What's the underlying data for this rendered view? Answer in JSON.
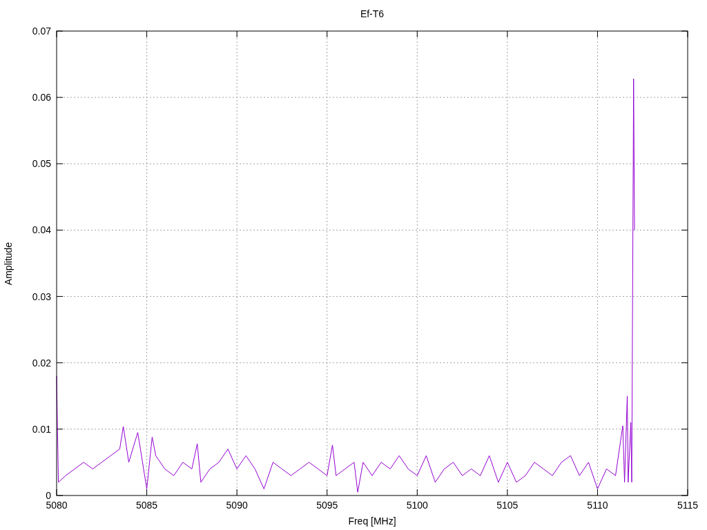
{
  "chart": {
    "chart_data": {
      "type": "line",
      "title": "Ef-T6",
      "xlabel": "Freq [MHz]",
      "ylabel": "Amplitude",
      "grid": true,
      "xlim": [
        5080,
        5115
      ],
      "ylim": [
        0,
        0.07
      ],
      "xticks": [
        5080,
        5085,
        5090,
        5095,
        5100,
        5105,
        5110,
        5115
      ],
      "yticks": [
        {
          "value": 0,
          "label": "0"
        },
        {
          "value": 0.01,
          "label": "0.01"
        },
        {
          "value": 0.02,
          "label": "0.02"
        },
        {
          "value": 0.03,
          "label": "0.03"
        },
        {
          "value": 0.04,
          "label": "0.04"
        },
        {
          "value": 0.05,
          "label": "0.05"
        },
        {
          "value": 0.06,
          "label": "0.06"
        },
        {
          "value": 0.07,
          "label": "0.07"
        }
      ],
      "x": [
        5080,
        5080.1,
        5080.5,
        5081,
        5081.5,
        5082,
        5082.5,
        5083,
        5083.5,
        5083.7,
        5084,
        5084.5,
        5085,
        5085.3,
        5085.5,
        5086,
        5086.5,
        5087,
        5087.5,
        5087.8,
        5088,
        5088.5,
        5089,
        5089.5,
        5090,
        5090.5,
        5091,
        5091.5,
        5092,
        5092.5,
        5093,
        5093.5,
        5094,
        5094.5,
        5095,
        5095.3,
        5095.5,
        5096,
        5096.5,
        5096.7,
        5097,
        5097.5,
        5098,
        5098.5,
        5099,
        5099.5,
        5100,
        5100.5,
        5101,
        5101.5,
        5102,
        5102.5,
        5103,
        5103.5,
        5104,
        5104.5,
        5105,
        5105.5,
        5106,
        5106.5,
        5107,
        5107.5,
        5108,
        5108.5,
        5109,
        5109.5,
        5110,
        5110.5,
        5111,
        5111.4,
        5111.5,
        5111.65,
        5111.7,
        5111.85,
        5111.9,
        5112,
        5112.05
      ],
      "series": [
        {
          "color": "#9400d3",
          "values": [
            0.018,
            0.002,
            0.003,
            0.004,
            0.005,
            0.004,
            0.005,
            0.006,
            0.007,
            0.0104,
            0.005,
            0.0095,
            0.001,
            0.0088,
            0.006,
            0.004,
            0.003,
            0.005,
            0.004,
            0.0078,
            0.002,
            0.004,
            0.005,
            0.007,
            0.004,
            0.006,
            0.004,
            0.001,
            0.005,
            0.004,
            0.003,
            0.004,
            0.005,
            0.004,
            0.003,
            0.0076,
            0.003,
            0.004,
            0.005,
            0.0005,
            0.005,
            0.003,
            0.005,
            0.004,
            0.006,
            0.004,
            0.003,
            0.006,
            0.002,
            0.004,
            0.005,
            0.003,
            0.004,
            0.003,
            0.006,
            0.002,
            0.005,
            0.002,
            0.003,
            0.005,
            0.004,
            0.003,
            0.005,
            0.006,
            0.003,
            0.005,
            0.001,
            0.004,
            0.003,
            0.0105,
            0.002,
            0.015,
            0.002,
            0.011,
            0.002,
            0.0628,
            0.04
          ]
        }
      ]
    }
  }
}
